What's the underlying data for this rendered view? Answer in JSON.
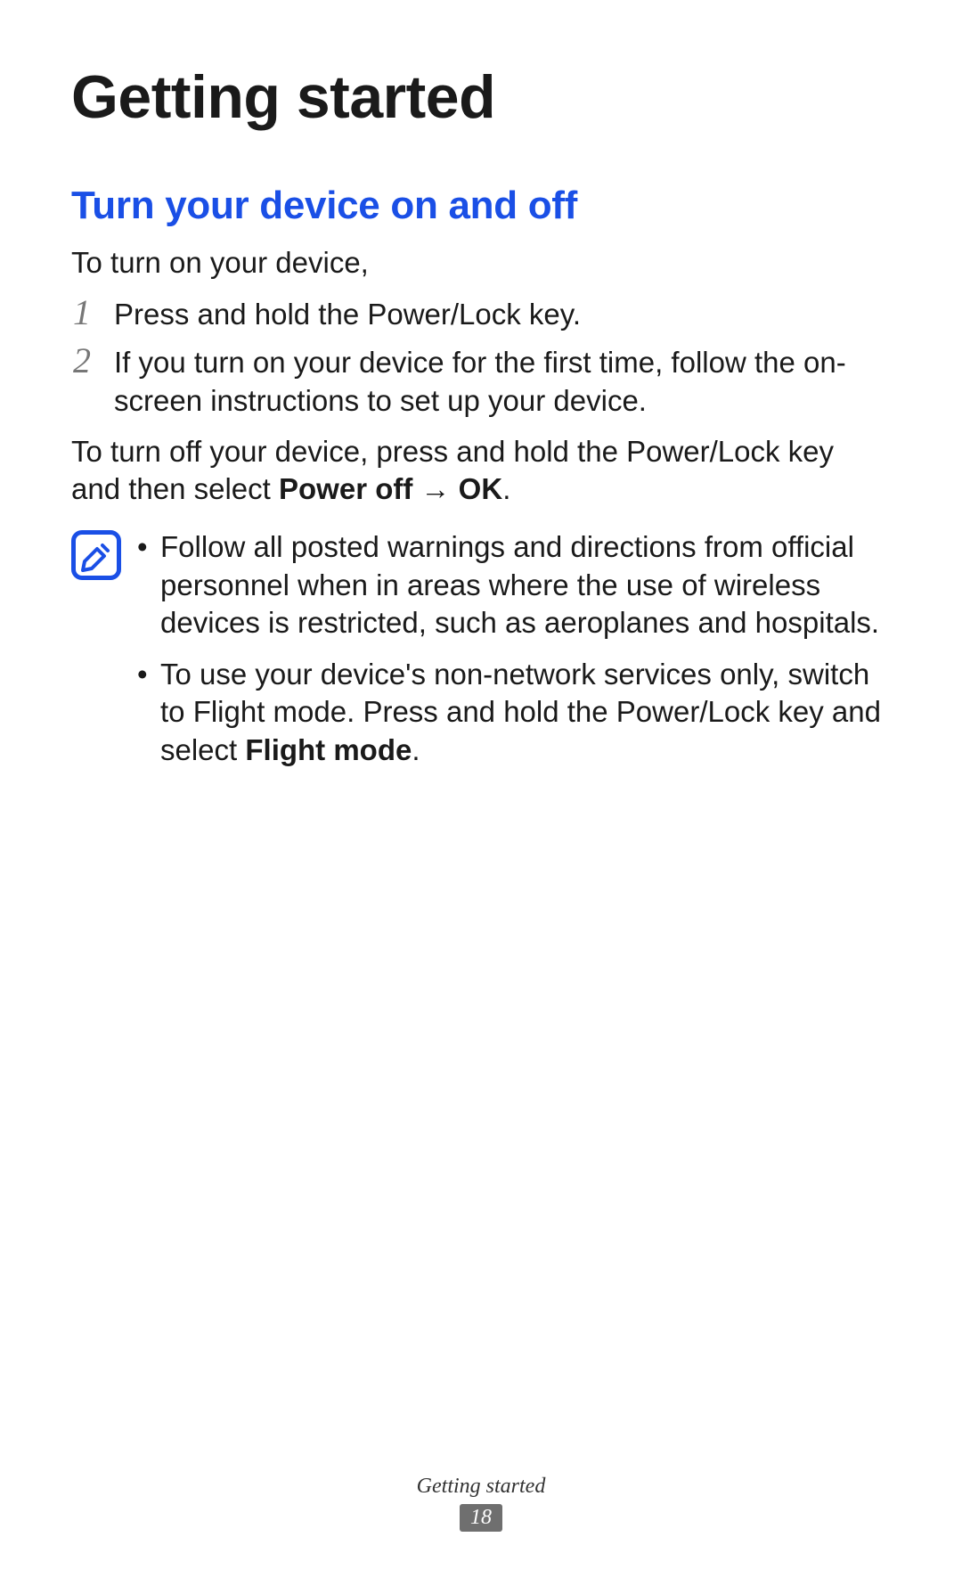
{
  "chapter_title": "Getting started",
  "section_title": "Turn your device on and off",
  "intro": "To turn on your device,",
  "steps": [
    {
      "num": "1",
      "text": "Press and hold the Power/Lock key."
    },
    {
      "num": "2",
      "text": "If you turn on your device for the first time, follow the on-screen instructions to set up your device."
    }
  ],
  "turn_off": {
    "prefix": "To turn off your device, press and hold the Power/Lock key and then select ",
    "bold": "Power off → OK",
    "suffix": "."
  },
  "notes": [
    {
      "text": "Follow all posted warnings and directions from official personnel when in areas where the use of wireless devices is restricted, such as aeroplanes and hospitals."
    },
    {
      "prefix": "To use your device's non-network services only, switch to Flight mode. Press and hold the Power/Lock key and select ",
      "bold": "Flight mode",
      "suffix": "."
    }
  ],
  "footer_label": "Getting started",
  "page_number": "18"
}
